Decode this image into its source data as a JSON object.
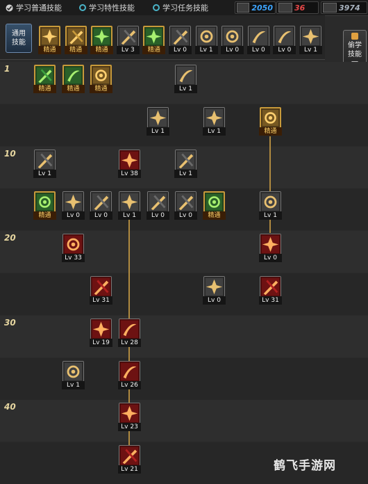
{
  "tabs": [
    {
      "label": "学习普通技能",
      "checked": true
    },
    {
      "label": "学习特性技能",
      "checked": false
    },
    {
      "label": "学习任务技能",
      "checked": false
    }
  ],
  "points": [
    {
      "value": "2050",
      "color": "#3da5ff"
    },
    {
      "value": "36",
      "color": "#e84848"
    },
    {
      "value": "3974",
      "color": "#aab4c0"
    }
  ],
  "common_label": "通用\n技能",
  "steal_label": "偷学\n技能",
  "level_markers": [
    "1",
    "10",
    "20",
    "30",
    "40"
  ],
  "mastered_text": "精通",
  "common_skills": [
    {
      "badge": "精通",
      "icon": "figure-icon",
      "style": "gold"
    },
    {
      "badge": "精通",
      "icon": "swirl-icon",
      "style": "gold"
    },
    {
      "badge": "精通",
      "icon": "runner-icon",
      "style": "green"
    },
    {
      "badge": "Lv 3",
      "icon": "wings-icon",
      "style": "plain"
    },
    {
      "badge": "精通",
      "icon": "target-icon",
      "style": "green"
    },
    {
      "badge": "Lv 0",
      "icon": "crosshair-icon",
      "style": "plain"
    },
    {
      "badge": "Lv 1",
      "icon": "dash-icon",
      "style": "plain"
    },
    {
      "badge": "Lv 0",
      "icon": "buff-icon",
      "style": "plain"
    },
    {
      "badge": "Lv 0",
      "icon": "eye-icon",
      "style": "plain"
    },
    {
      "badge": "Lv 0",
      "icon": "warrior-icon",
      "style": "plain"
    },
    {
      "badge": "Lv 1",
      "icon": "potion-icon",
      "style": "plain"
    }
  ],
  "tree_skills": [
    {
      "row": 0,
      "col": 0,
      "badge": "精通",
      "icon": "slash-icon",
      "style": "green"
    },
    {
      "row": 0,
      "col": 1,
      "badge": "精通",
      "icon": "eye-icon",
      "style": "green"
    },
    {
      "row": 0,
      "col": 2,
      "badge": "精通",
      "icon": "claw-icon",
      "style": "gold"
    },
    {
      "row": 0,
      "col": 5,
      "badge": "Lv 1",
      "icon": "arc-icon",
      "style": "plain"
    },
    {
      "row": 1,
      "col": 4,
      "badge": "Lv 1",
      "icon": "arrows-icon",
      "style": "plain"
    },
    {
      "row": 1,
      "col": 6,
      "badge": "Lv 1",
      "icon": "strike-icon",
      "style": "plain"
    },
    {
      "row": 1,
      "col": 8,
      "badge": "精通",
      "icon": "shield-cross-icon",
      "style": "gold"
    },
    {
      "row": 2,
      "col": 0,
      "badge": "Lv 1",
      "icon": "sweep-icon",
      "style": "plain"
    },
    {
      "row": 2,
      "col": 3,
      "badge": "Lv 38",
      "icon": "spiral-icon",
      "style": "red"
    },
    {
      "row": 2,
      "col": 5,
      "badge": "Lv 1",
      "icon": "flash-icon",
      "style": "plain"
    },
    {
      "row": 3,
      "col": 0,
      "badge": "精通",
      "icon": "fist-icon",
      "style": "green"
    },
    {
      "row": 3,
      "col": 1,
      "badge": "Lv 0",
      "icon": "dagger-icon",
      "style": "plain"
    },
    {
      "row": 3,
      "col": 2,
      "badge": "Lv 0",
      "icon": "blade-icon",
      "style": "plain"
    },
    {
      "row": 3,
      "col": 3,
      "badge": "Lv 1",
      "icon": "twin-blade-icon",
      "style": "plain"
    },
    {
      "row": 3,
      "col": 4,
      "badge": "Lv 0",
      "icon": "sword-icon",
      "style": "plain"
    },
    {
      "row": 3,
      "col": 5,
      "badge": "Lv 0",
      "icon": "burst-icon",
      "style": "plain"
    },
    {
      "row": 3,
      "col": 6,
      "badge": "精通",
      "icon": "cross-swords-icon",
      "style": "green"
    },
    {
      "row": 3,
      "col": 8,
      "badge": "Lv 1",
      "icon": "shield-spark-icon",
      "style": "plain"
    },
    {
      "row": 4,
      "col": 1,
      "badge": "Lv 33",
      "icon": "crescent-red-icon",
      "style": "red"
    },
    {
      "row": 4,
      "col": 8,
      "badge": "Lv 0",
      "icon": "pillar-icon",
      "style": "red"
    },
    {
      "row": 5,
      "col": 2,
      "badge": "Lv 31",
      "icon": "flame-icon",
      "style": "red"
    },
    {
      "row": 5,
      "col": 6,
      "badge": "Lv 0",
      "icon": "impact-icon",
      "style": "plain"
    },
    {
      "row": 5,
      "col": 8,
      "badge": "Lv 31",
      "icon": "slash-red-icon",
      "style": "red"
    },
    {
      "row": 6,
      "col": 2,
      "badge": "Lv 19",
      "icon": "fire-sweep-icon",
      "style": "red"
    },
    {
      "row": 6,
      "col": 3,
      "badge": "Lv 28",
      "icon": "multi-sword-icon",
      "style": "red"
    },
    {
      "row": 7,
      "col": 1,
      "badge": "Lv 1",
      "icon": "moon-icon",
      "style": "plain"
    },
    {
      "row": 7,
      "col": 3,
      "badge": "Lv 26",
      "icon": "phoenix-icon",
      "style": "red"
    },
    {
      "row": 8,
      "col": 3,
      "badge": "Lv 23",
      "icon": "star-burst-icon",
      "style": "red"
    },
    {
      "row": 9,
      "col": 3,
      "badge": "Lv 21",
      "icon": "explosion-icon",
      "style": "red"
    }
  ],
  "watermark": "鹤飞手游网"
}
